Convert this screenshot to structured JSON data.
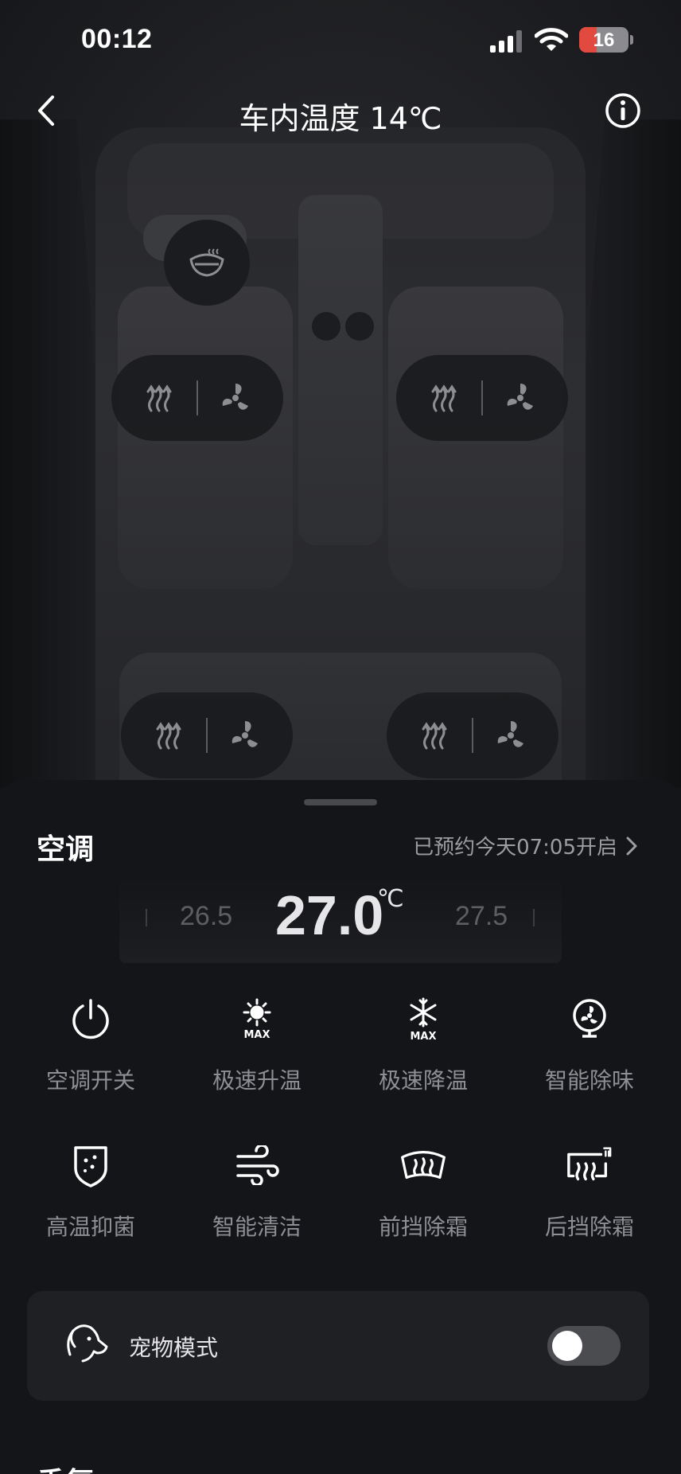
{
  "status_bar": {
    "time": "00:12",
    "battery": "16",
    "battery_level_percent": 16
  },
  "nav": {
    "title": "车内温度 14℃"
  },
  "car": {
    "steering_heat_icon": "steering-wheel-heat-icon",
    "seats": [
      {
        "id": "front-left",
        "heat_icon": "seat-heat-icon",
        "vent_icon": "seat-ventilation-icon"
      },
      {
        "id": "front-right",
        "heat_icon": "seat-heat-icon",
        "vent_icon": "seat-ventilation-icon"
      },
      {
        "id": "rear-left",
        "heat_icon": "seat-heat-icon",
        "vent_icon": "seat-ventilation-icon"
      },
      {
        "id": "rear-right",
        "heat_icon": "seat-heat-icon",
        "vent_icon": "seat-ventilation-icon"
      }
    ]
  },
  "ac": {
    "title": "空调",
    "schedule": "已预约今天07:05开启",
    "temp_prev": "26.5",
    "temp_current": "27.0",
    "temp_unit": "℃",
    "temp_next": "27.5",
    "functions": [
      {
        "label": "空调开关",
        "icon": "power-icon"
      },
      {
        "label": "极速升温",
        "icon": "max-heat-icon"
      },
      {
        "label": "极速降温",
        "icon": "max-cool-icon"
      },
      {
        "label": "智能除味",
        "icon": "deodorize-fan-icon"
      },
      {
        "label": "高温抑菌",
        "icon": "sterilize-shield-icon"
      },
      {
        "label": "智能清洁",
        "icon": "wind-clean-icon"
      },
      {
        "label": "前挡除霜",
        "icon": "front-defrost-icon"
      },
      {
        "label": "后挡除霜",
        "icon": "rear-defrost-icon"
      }
    ],
    "pet_mode": {
      "label": "宠物模式",
      "icon": "pet-dog-icon",
      "enabled": false
    }
  },
  "next_section": {
    "title": "香氛"
  },
  "colors": {
    "background": "#141518",
    "card": "#1f2023",
    "battery_low": "#e34a3f"
  }
}
